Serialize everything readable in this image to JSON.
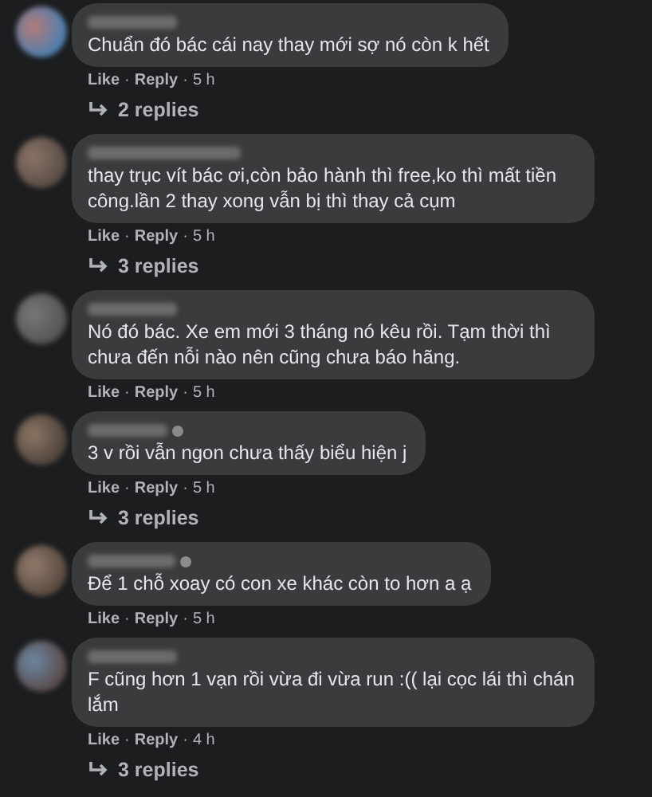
{
  "separator": "·",
  "comments": [
    {
      "text": "Chuẩn đó bác cái nay thay mới sợ nó còn k hết",
      "name_badge": false,
      "like": "Like",
      "reply": "Reply",
      "time": "5 h",
      "replies": "2 replies"
    },
    {
      "text": "thay trục vít bác ơi,còn bảo hành thì free,ko thì mất tiền công.lần 2 thay xong vẫn bị thì thay cả cụm",
      "name_badge": false,
      "like": "Like",
      "reply": "Reply",
      "time": "5 h",
      "replies": "3 replies"
    },
    {
      "text": "Nó đó bác. Xe em mới 3 tháng nó kêu rồi. Tạm thời thì chưa đến nỗi nào nên cũng chưa báo hãng.",
      "name_badge": false,
      "like": "Like",
      "reply": "Reply",
      "time": "5 h"
    },
    {
      "text": "3 v rồi vẫn ngon chưa thấy biểu hiện j",
      "name_badge": true,
      "like": "Like",
      "reply": "Reply",
      "time": "5 h",
      "replies": "3 replies"
    },
    {
      "text": "Để 1 chỗ xoay có con xe khác còn to hơn a ạ",
      "name_badge": true,
      "like": "Like",
      "reply": "Reply",
      "time": "5 h"
    },
    {
      "text": "F cũng hơn 1 vạn rồi vừa đi vừa run :(( lại cọc lái thì chán lắm",
      "name_badge": false,
      "like": "Like",
      "reply": "Reply",
      "time": "4 h",
      "replies": "3 replies"
    }
  ]
}
